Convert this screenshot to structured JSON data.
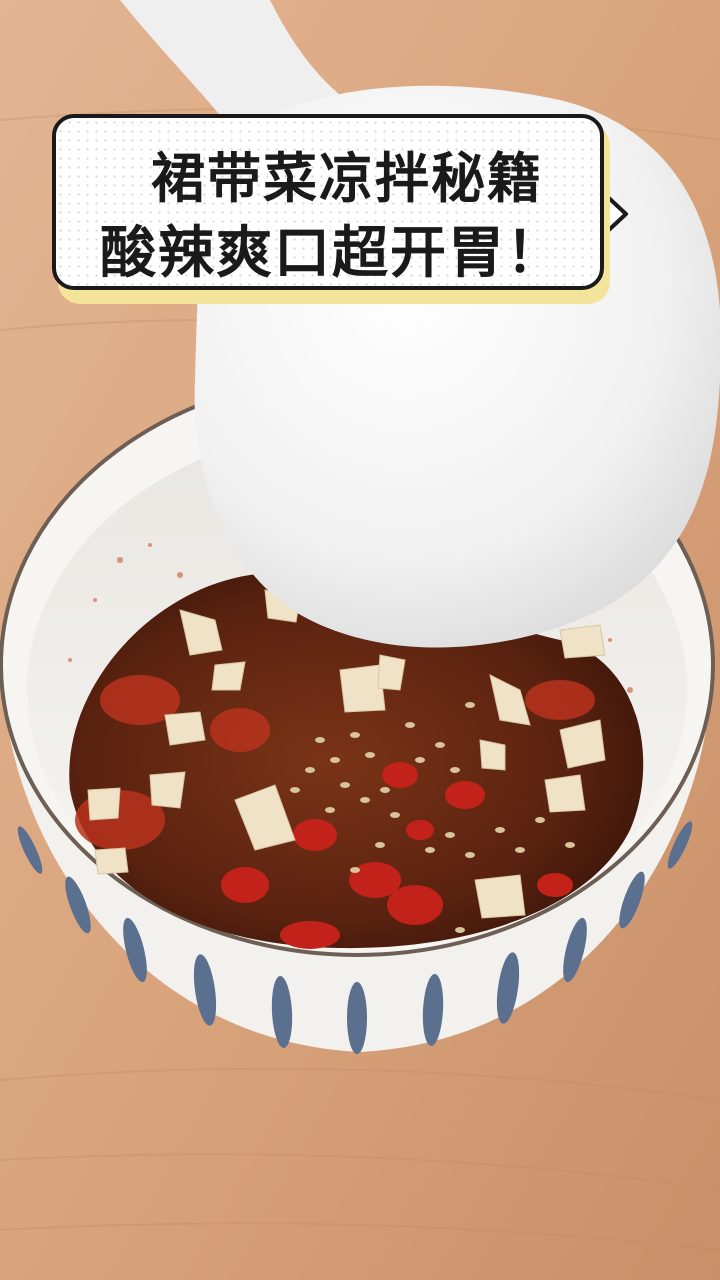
{
  "caption": {
    "line1": "裙带菜凉拌秘籍",
    "line2": "酸辣爽口超开胃！"
  },
  "colors": {
    "table_wood": "#d9a47c",
    "bowl_white": "#f3f1ee",
    "bowl_stripe": "#5b6f8e",
    "sauce_dark": "#5a2210",
    "chili_red": "#c3221b",
    "garlic": "#f0e2c6",
    "sesame": "#d8c49a",
    "spoon_white": "#f1f1f1",
    "caption_shadow": "#f4e39a"
  }
}
